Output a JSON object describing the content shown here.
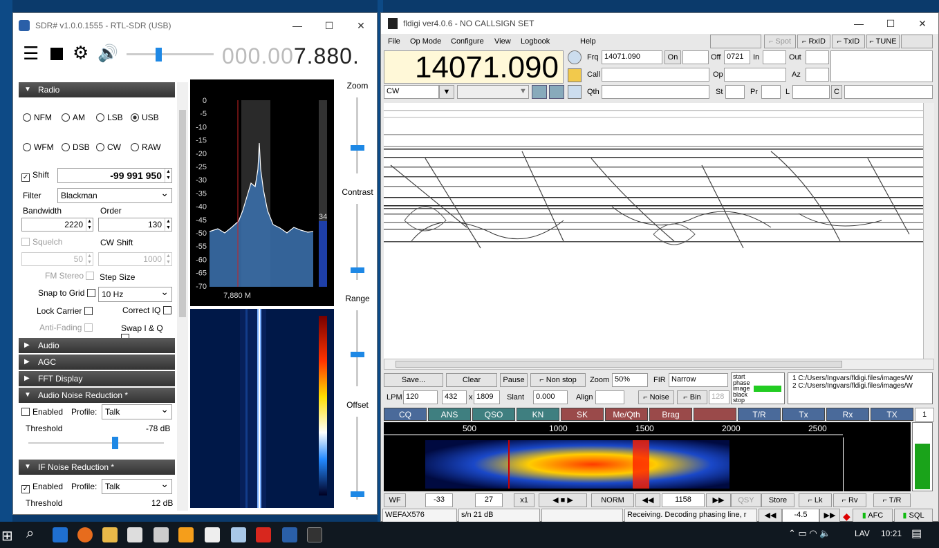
{
  "sdr": {
    "title": "SDR# v1.0.0.1555 - RTL-SDR (USB)",
    "freq_dim": "000.00",
    "freq_bright": "7.880.",
    "sections": {
      "radio": "Radio",
      "audio": "Audio",
      "agc": "AGC",
      "fft": "FFT Display",
      "anr": "Audio Noise Reduction *",
      "ifnr": "IF Noise Reduction *"
    },
    "modes": [
      "NFM",
      "AM",
      "LSB",
      "USB",
      "WFM",
      "DSB",
      "CW",
      "RAW"
    ],
    "shift_label": "Shift",
    "shift_value": "-99 991 950",
    "filter_label": "Filter",
    "filter_value": "Blackman",
    "bandwidth_label": "Bandwidth",
    "bandwidth_value": "2220",
    "order_label": "Order",
    "order_value": "130",
    "squelch_label": "Squelch",
    "squelch_value": "50",
    "cwshift_label": "CW Shift",
    "cwshift_value": "1000",
    "fmstereo_label": "FM Stereo",
    "stepsize_label": "Step Size",
    "snap_label": "Snap to Grid",
    "step_value": "10 Hz",
    "lock_label": "Lock Carrier",
    "correctiq_label": "Correct IQ",
    "antifading_label": "Anti-Fading",
    "swapiq_label": "Swap I & Q",
    "enabled_label": "Enabled",
    "profile_label": "Profile:",
    "profile_value": "Talk",
    "threshold_label": "Threshold",
    "anr_threshold": "-78 dB",
    "ifnr_threshold": "12 dB",
    "db_ticks": [
      "0",
      "-5",
      "-10",
      "-15",
      "-20",
      "-25",
      "-30",
      "-35",
      "-40",
      "-45",
      "-50",
      "-55",
      "-60",
      "-65",
      "-70"
    ],
    "spec_freq_label": "7,880 M",
    "level_value": "34",
    "sliders": {
      "zoom": "Zoom",
      "contrast": "Contrast",
      "range": "Range",
      "offset": "Offset"
    }
  },
  "fldigi": {
    "title": "fldigi ver4.0.6 - NO CALLSIGN SET",
    "menu": [
      "File",
      "Op Mode",
      "Configure",
      "View",
      "Logbook",
      "Help"
    ],
    "top_btns": {
      "spot": "Spot",
      "rxid": "RxID",
      "txid": "TxID",
      "tune": "TUNE"
    },
    "freq": "14071.090",
    "frq_label": "Frq",
    "frq_value": "14071.090",
    "on_label": "On",
    "off_label": "Off",
    "off_value": "0721",
    "in_label": "In",
    "out_label": "Out",
    "call_label": "Call",
    "op_label": "Op",
    "az_label": "Az",
    "mode_value": "CW",
    "qth_label": "Qth",
    "st_label": "St",
    "pr_label": "Pr",
    "l_label": "L",
    "c_label": "C",
    "ctrl": {
      "save": "Save...",
      "clear": "Clear",
      "pause": "Pause",
      "nonstop": "Non stop",
      "zoom": "Zoom",
      "zoom_val": "50%",
      "fir": "FIR",
      "fir_val": "Narrow",
      "lpm": "LPM",
      "lpm_val": "120",
      "w": "432",
      "x": "x",
      "h": "1809",
      "slant": "Slant",
      "slant_val": "0.000",
      "align": "Align",
      "noise": "Noise",
      "bin": "Bin",
      "bin_val": "128"
    },
    "status_box": [
      "start",
      "phase",
      "image",
      "black",
      "stop"
    ],
    "files": [
      "1 C:/Users/Ingvars/fldigi.files/images/W",
      "2 C:/Users/Ingvars/fldigi.files/images/W"
    ],
    "macros": [
      "CQ",
      "ANS",
      "QSO",
      "KN",
      "SK",
      "Me/Qth",
      "Brag",
      "",
      "T/R",
      "Tx",
      "Rx",
      "TX"
    ],
    "macro_page": "1",
    "scale": [
      "500",
      "1000",
      "1500",
      "2000",
      "2500"
    ],
    "wf": {
      "wf": "WF",
      "lvl1": "-33",
      "lvl2": "27",
      "x1": "x1",
      "norm": "NORM",
      "freq": "1158",
      "qsy": "QSY",
      "store": "Store",
      "lk": "Lk",
      "rv": "Rv",
      "tr": "T/R"
    },
    "status": {
      "mode": "WEFAX576",
      "sn": "s/n  21 dB",
      "msg": "Receiving. Decoding phasing line, r",
      "val": "-4.5",
      "afc": "AFC",
      "sql": "SQL"
    }
  },
  "taskbar": {
    "lang": "LAV",
    "time": "10:21"
  },
  "colors": {
    "sdr_section": "#3a3a3a",
    "macro_blue": "#4a6a9a",
    "macro_teal": "#3f7f80",
    "macro_red": "#9a4a4a",
    "taskbar": "#101820"
  }
}
